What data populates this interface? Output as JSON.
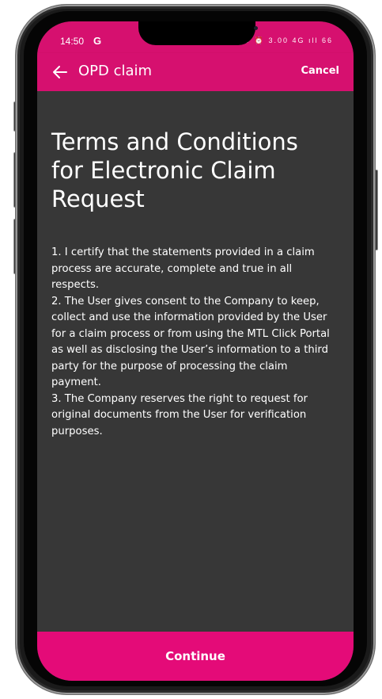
{
  "colors": {
    "brand_magenta": "#d6106f",
    "button_magenta": "#e40b78",
    "content_background": "#373737",
    "text": "#ffffff"
  },
  "status_bar": {
    "time": "14:50",
    "app_indicator": "G",
    "indicator_icons": "N ✈ ⊙ ⏰ 3.00 4G ıll 66"
  },
  "app_bar": {
    "back_icon": "arrow-left-icon",
    "title": "OPD claim",
    "cancel_label": "Cancel"
  },
  "content": {
    "heading": "Terms and Conditions for Electronic Claim Request",
    "terms": [
      "1. I certify that the statements provided in a claim process are accurate, complete and true in all respects.",
      "2. The User gives consent to the Company to keep, collect and use the information provided by the User for a claim process or from using the MTL Click Portal as well as disclosing the User’s information to a third party for the purpose of processing the claim payment.",
      "3. The Company reserves the right to request for original documents from the User for verification purposes."
    ]
  },
  "footer": {
    "continue_label": "Continue"
  }
}
